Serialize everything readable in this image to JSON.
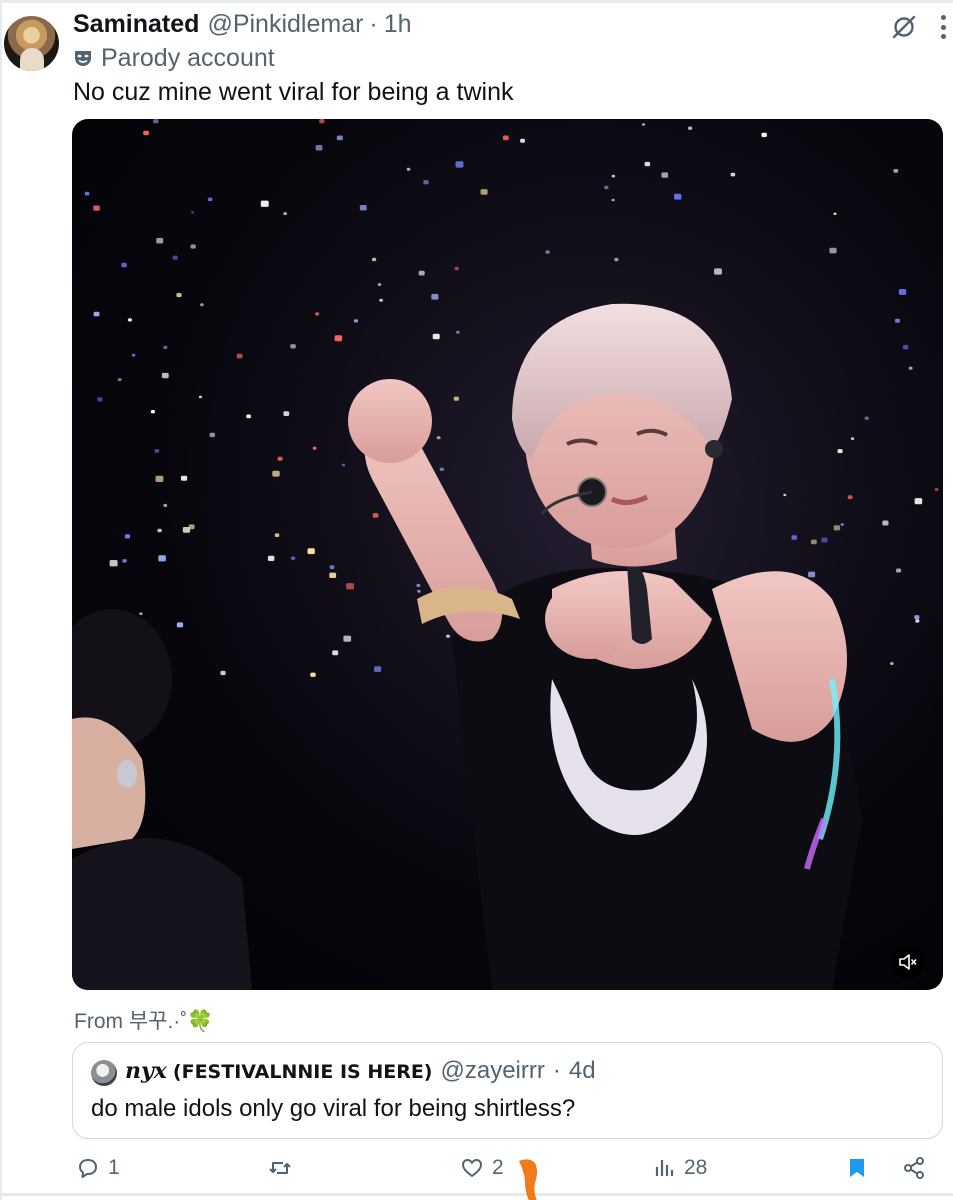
{
  "post": {
    "display_name": "Saminated",
    "handle": "@Pinkidlemar",
    "separator": "·",
    "time": "1h",
    "badge": "Parody account",
    "text": "No cuz mine went viral for being a twink",
    "media_credit": "From 부꾸.·˚",
    "media_credit_emoji": "🍀"
  },
  "quote": {
    "name_script": "nyx",
    "name_rest": "(FESTIVALNNIE IS HERE)",
    "handle": "@zayeirrr",
    "separator": "·",
    "time": "4d",
    "text": "do male idols only go viral for being shirtless?"
  },
  "actions": {
    "replies": "1",
    "reposts": "",
    "likes": "2",
    "views": "28"
  },
  "icons": {
    "grok": "grok-icon",
    "more": "more-dots-icon",
    "parody": "mask-icon",
    "mute": "volume-muted-icon",
    "reply": "reply-icon",
    "repost": "repost-icon",
    "like": "heart-icon",
    "views": "bar-chart-icon",
    "bookmark": "bookmark-icon",
    "share": "share-icon"
  },
  "colors": {
    "text_primary": "#0f1419",
    "text_secondary": "#536471",
    "accent": "#1d9bf0",
    "border": "#cfd9de",
    "cursor_mark": "#f27a1a"
  }
}
